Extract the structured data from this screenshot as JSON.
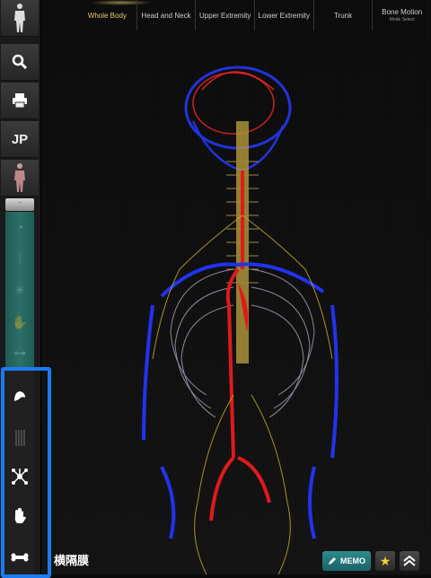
{
  "top_nav": {
    "tabs": [
      {
        "label": "Whole Body",
        "active": true
      },
      {
        "label": "Head and Neck",
        "active": false
      },
      {
        "label": "Upper Extremity",
        "active": false
      },
      {
        "label": "Lower Extremity",
        "active": false
      },
      {
        "label": "Trunk",
        "active": false
      },
      {
        "label": "Bone Motion",
        "sub": "Mode Select",
        "active": false
      }
    ]
  },
  "sidebar": {
    "buttons": [
      {
        "icon": "body-figure-icon"
      },
      {
        "icon": "search-icon"
      },
      {
        "icon": "print-icon"
      },
      {
        "label": "JP"
      },
      {
        "icon": "muscle-figure-icon"
      }
    ],
    "teal_items": [
      "muscle-icon",
      "bone-icon",
      "nerve-icon",
      "hand-icon",
      "joint-icon"
    ],
    "dark_items": [
      "muscle-icon",
      "ligament-icon",
      "nerve-network-icon",
      "hand-icon",
      "bone-icon"
    ]
  },
  "caption": "横隔膜",
  "memo_label": "MEMO",
  "colors": {
    "accent_tab": "#e8c86a",
    "teal": "#2c7068",
    "highlight_border": "#1a7cf5",
    "memo": "#2c8a8e"
  }
}
